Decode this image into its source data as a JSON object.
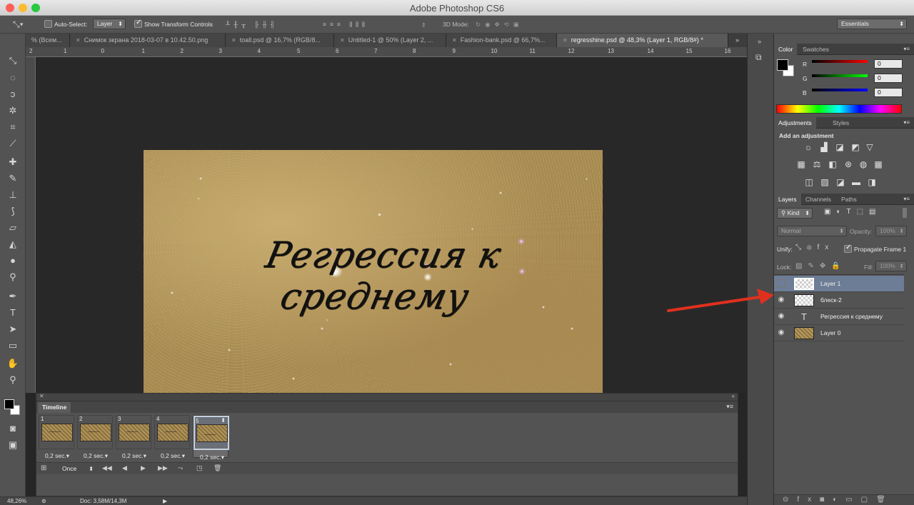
{
  "window": {
    "title": "Adobe Photoshop CS6"
  },
  "options_bar": {
    "auto_select_label": "Auto-Select:",
    "auto_select_value": "Layer",
    "show_transform_label": "Show Transform Controls",
    "mode_3d_label": "3D Mode:",
    "workspace": "Essentials"
  },
  "tabs": [
    {
      "label": "% (Всем..."
    },
    {
      "label": "Снимок экрана 2018-03-07 в 10.42.50.png"
    },
    {
      "label": "toall.psd @ 16,7% (RGB/8..."
    },
    {
      "label": "Untitled-1 @ 50% (Layer 2, ..."
    },
    {
      "label": "Fashion-bank.psd @ 66,7%..."
    },
    {
      "label": "regresshine.psd @ 48,3% (Layer 1, RGB/8#) *"
    }
  ],
  "ruler": [
    "2",
    "1",
    "0",
    "1",
    "2",
    "3",
    "4",
    "5",
    "6",
    "7",
    "8",
    "9",
    "10",
    "11",
    "12",
    "13",
    "14",
    "15",
    "16"
  ],
  "canvas": {
    "text": "Регрессия к среднему"
  },
  "timeline": {
    "title": "Timeline",
    "frames": [
      {
        "num": "1",
        "delay": "0,2 sec.▾"
      },
      {
        "num": "2",
        "delay": "0,2 sec.▾"
      },
      {
        "num": "3",
        "delay": "0,2 sec.▾"
      },
      {
        "num": "4",
        "delay": "0,2 sec.▾"
      },
      {
        "num": "5",
        "delay": "0,2 sec.▾"
      }
    ],
    "loop": "Once"
  },
  "status": {
    "zoom": "48,26%",
    "doc": "Doc: 3,58M/14,3M"
  },
  "color_panel": {
    "tabs": [
      "Color",
      "Swatches"
    ],
    "channels": [
      {
        "name": "R",
        "value": "0"
      },
      {
        "name": "G",
        "value": "0"
      },
      {
        "name": "B",
        "value": "0"
      }
    ]
  },
  "adjustments_panel": {
    "tabs": [
      "Adjustments",
      "Styles"
    ],
    "heading": "Add an adjustment"
  },
  "layers_panel": {
    "tabs": [
      "Layers",
      "Channels",
      "Paths"
    ],
    "kind": "Kind",
    "blend_mode": "Normal",
    "opacity_label": "Opacity:",
    "opacity_value": "100%",
    "unify_label": "Unify:",
    "propagate_label": "Propagate Frame 1",
    "lock_label": "Lock:",
    "fill_label": "Fill:",
    "fill_value": "100%",
    "layers": [
      {
        "name": "Layer 1"
      },
      {
        "name": "блеск-2"
      },
      {
        "name": "Регрессия к среднему"
      },
      {
        "name": "Layer 0"
      }
    ]
  },
  "colors": {
    "accent_arrow": "#e0301e",
    "selected_layer": "#6d7d96"
  }
}
